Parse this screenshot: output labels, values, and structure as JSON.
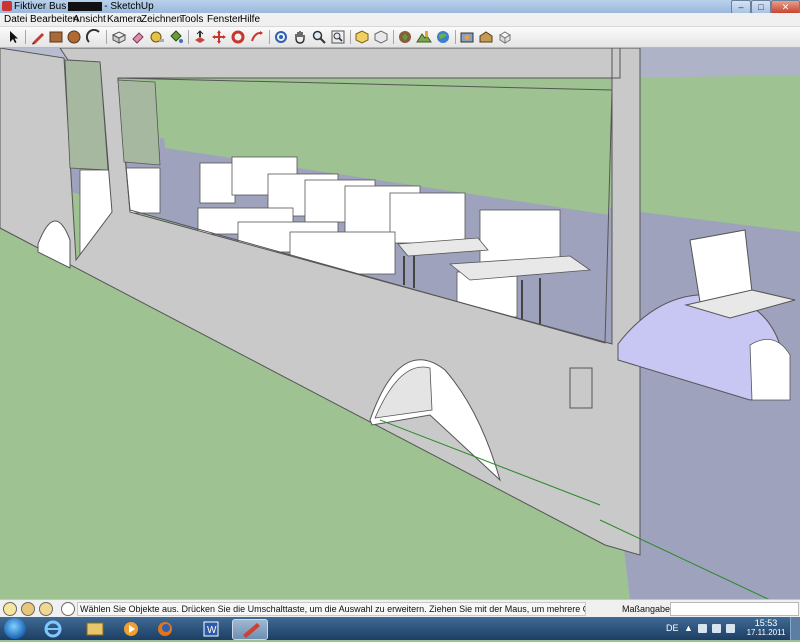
{
  "window": {
    "title_prefix": "Fiktiver Bus",
    "title_suffix": "- SketchUp",
    "min_label": "–",
    "max_label": "□",
    "close_label": "✕"
  },
  "menu": {
    "items": [
      "Datei",
      "Bearbeiten",
      "Ansicht",
      "Kamera",
      "Zeichnen",
      "Tools",
      "Fenster",
      "Hilfe"
    ]
  },
  "toolbar": {
    "tools": [
      "select-tool-icon",
      "pencil-tool-icon",
      "rectangle-tool-icon",
      "circle-tool-icon",
      "arc-tool-icon",
      "make-component-icon",
      "eraser-tool-icon",
      "tape-measure-icon",
      "paint-bucket-icon",
      "push-pull-icon",
      "move-tool-icon",
      "rotate-tool-icon",
      "follow-me-icon",
      "orbit-tool-icon",
      "pan-tool-icon",
      "zoom-tool-icon",
      "zoom-extents-icon",
      "get-models-icon",
      "share-model-icon",
      "add-location-icon",
      "toggle-terrain-icon",
      "preview-google-earth-icon",
      "photo-textures-icon",
      "warehouse-icon",
      "dynamic-components-icon",
      "component-options-icon"
    ]
  },
  "statusbar": {
    "message": "Wählen Sie Objekte aus. Drücken Sie die Umschalttaste, um die Auswahl zu erweitern. Ziehen Sie mit der Maus, um mehrere Objekte",
    "measure_label": "Maßangaben",
    "measure_value": ""
  },
  "taskbar": {
    "apps": [
      "internet-explorer-icon",
      "file-explorer-icon",
      "media-player-icon",
      "firefox-icon",
      "word-icon",
      "sketchup-icon"
    ],
    "lang": "DE",
    "tray_arrow": "▲",
    "time": "15:53",
    "date": "17.11.2011"
  },
  "colors": {
    "ground": "#9fc293",
    "sky": "#b2b8cc",
    "bus_wall": "#c9c9c9",
    "interior_floor": "#9ea2bd",
    "seat": "#ffffff",
    "wheel_arch_light": "#c8c6f2"
  }
}
